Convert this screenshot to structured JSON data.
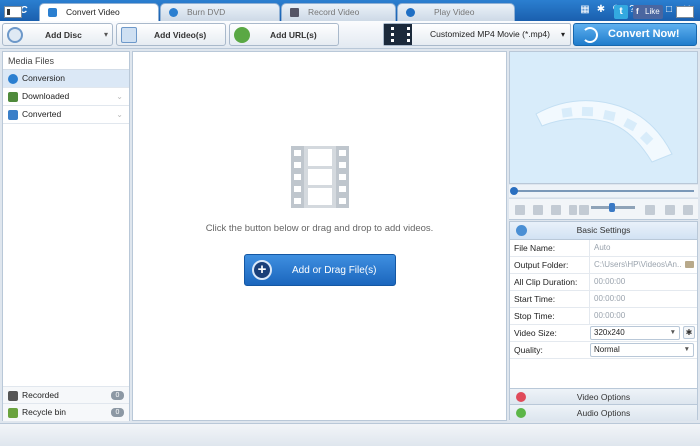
{
  "app": {
    "logo": "AVC"
  },
  "tabs": [
    {
      "label": "Convert Video",
      "active": true
    },
    {
      "label": "Burn DVD",
      "active": false
    },
    {
      "label": "Record Video",
      "active": false
    },
    {
      "label": "Play Video",
      "active": false
    }
  ],
  "window_controls": [
    "skin-icon",
    "settings-icon",
    "tools-icon",
    "help-icon",
    "minimize-icon",
    "maximize-icon",
    "close-icon"
  ],
  "toolbar": {
    "add_disc": "Add Disc",
    "add_videos": "Add Video(s)",
    "add_urls": "Add URL(s)",
    "profile": "Customized MP4 Movie (*.mp4)",
    "convert": "Convert Now!"
  },
  "sidebar": {
    "header": "Media Files",
    "items": [
      {
        "label": "Conversion"
      },
      {
        "label": "Downloaded"
      },
      {
        "label": "Converted"
      }
    ],
    "bottom": [
      {
        "label": "Recorded",
        "count": "0"
      },
      {
        "label": "Recycle bin",
        "count": "0"
      }
    ]
  },
  "main": {
    "hint": "Click the button below or drag and drop to add videos.",
    "add_button": "Add or Drag File(s)"
  },
  "settings": {
    "header": "Basic Settings",
    "rows": [
      {
        "label": "File Name:",
        "value": "Auto"
      },
      {
        "label": "Output Folder:",
        "value": "C:\\Users\\HP\\Videos\\An..."
      },
      {
        "label": "All Clip Duration:",
        "value": "00:00:00"
      },
      {
        "label": "Start Time:",
        "value": "00:00:00"
      },
      {
        "label": "Stop Time:",
        "value": "00:00:00"
      },
      {
        "label": "Video Size:",
        "value": "320x240"
      },
      {
        "label": "Quality:",
        "value": "Normal"
      }
    ],
    "video_options": "Video Options",
    "audio_options": "Audio Options"
  },
  "statusbar": {
    "twitter": "t",
    "like": "Like"
  },
  "colors": {
    "accent": "#1f7ccc",
    "titlebar": "#1a5fae"
  }
}
